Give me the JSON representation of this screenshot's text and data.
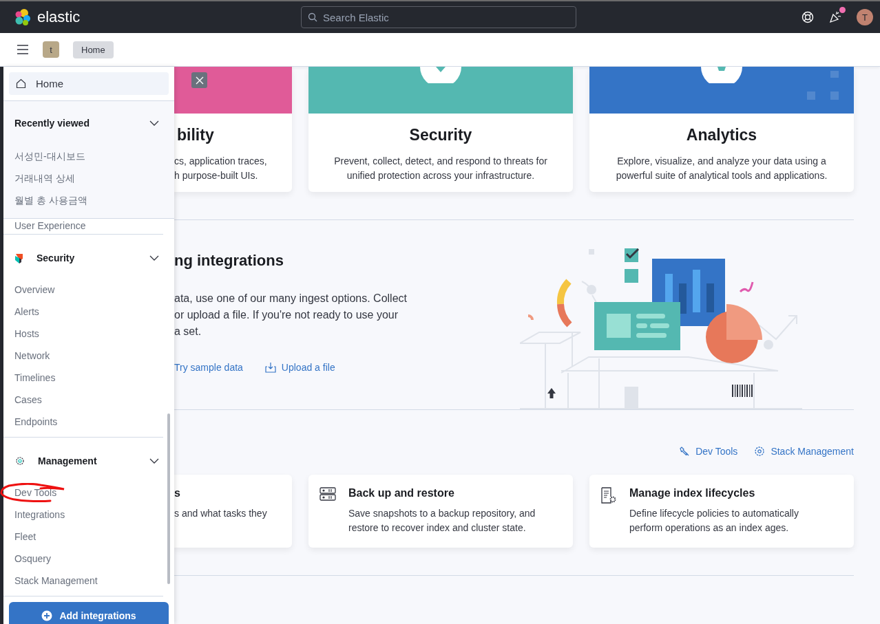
{
  "header": {
    "logo_text": "elastic",
    "search": {
      "placeholder": "Search Elastic"
    },
    "news_unread": true,
    "user_initial": "T"
  },
  "breadcrumbs": {
    "space_initial": "t",
    "items": [
      "Home"
    ]
  },
  "nav": {
    "home": {
      "label": "Home",
      "selected": true
    },
    "recent": {
      "title": "Recently viewed",
      "expanded": true,
      "items": [
        "서성민-대시보드",
        "거래내역 상세",
        "월별 총 사용금액"
      ]
    },
    "groups": [
      {
        "kind": "plain",
        "items": [
          {
            "label": "User Experience",
            "selected": false
          }
        ]
      },
      {
        "kind": "security",
        "title": "Security",
        "expanded": true,
        "items": [
          {
            "label": "Overview",
            "selected": false
          },
          {
            "label": "Alerts",
            "selected": false
          },
          {
            "label": "Hosts",
            "selected": false
          },
          {
            "label": "Network",
            "selected": false
          },
          {
            "label": "Timelines",
            "selected": false
          },
          {
            "label": "Cases",
            "selected": false
          },
          {
            "label": "Endpoints",
            "selected": false
          }
        ]
      },
      {
        "kind": "management",
        "title": "Management",
        "expanded": true,
        "items": [
          {
            "label": "Dev Tools",
            "selected": false,
            "marked": true
          },
          {
            "label": "Integrations",
            "selected": false
          },
          {
            "label": "Fleet",
            "selected": false
          },
          {
            "label": "Osquery",
            "selected": false
          },
          {
            "label": "Stack Management",
            "selected": false
          }
        ]
      }
    ],
    "add_button": "Add integrations"
  },
  "solutions": [
    {
      "kind": "observability",
      "title": "bility",
      "description_lines": [
        "cs, application traces,",
        "h purpose-built UIs."
      ],
      "color": "#e05b98",
      "dismissible": true
    },
    {
      "kind": "security",
      "title": "Security",
      "description_lines": [
        "Prevent, collect, detect, and respond to threats for",
        "unified protection across your infrastructure."
      ],
      "color": "#54b8b1"
    },
    {
      "kind": "analytics",
      "title": "Analytics",
      "description_lines": [
        "Explore, visualize, and analyze your data using a",
        "powerful suite of analytical tools and applications."
      ],
      "color": "#3474c6"
    }
  ],
  "ingest": {
    "title": "ng integrations",
    "description_lines": [
      "ata, use one of our many ingest options. Collect",
      "or upload a file. If you're not ready to use your",
      "a set."
    ],
    "links": [
      {
        "kind": "sample",
        "label": "Try sample data"
      },
      {
        "kind": "upload",
        "label": "Upload a file"
      }
    ]
  },
  "management": {
    "links": [
      {
        "kind": "wrench",
        "label": "Dev Tools"
      },
      {
        "kind": "gear",
        "label": "Stack Management"
      }
    ],
    "cards": [
      {
        "kind": "none",
        "title": "s",
        "description_lines": [
          "s and what tasks they"
        ]
      },
      {
        "kind": "backup",
        "title": "Back up and restore",
        "description_lines": [
          "Save snapshots to a backup repository, and",
          "restore to recover index and cluster state."
        ]
      },
      {
        "kind": "lifecycle",
        "title": "Manage index lifecycles",
        "description_lines": [
          "Define lifecycle policies to automatically",
          "perform operations as an index ages."
        ]
      }
    ]
  }
}
